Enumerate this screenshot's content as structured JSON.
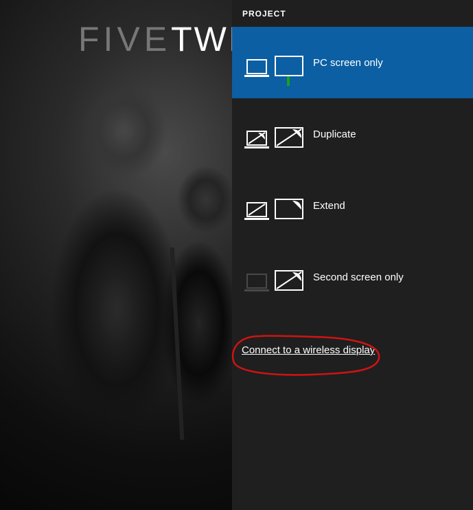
{
  "wallpaper": {
    "text_thin": "FIVE",
    "text_bold": "TWI"
  },
  "panel": {
    "title": "PROJECT",
    "options": [
      {
        "label": "PC screen only",
        "selected": true
      },
      {
        "label": "Duplicate",
        "selected": false
      },
      {
        "label": "Extend",
        "selected": false
      },
      {
        "label": "Second screen only",
        "selected": false
      }
    ],
    "wireless_link": "Connect to a wireless display"
  },
  "colors": {
    "panel_bg": "#1f1f1f",
    "selected_bg": "#0c5fa3",
    "indicator": "#1aa21a",
    "annotation": "#d11313"
  }
}
